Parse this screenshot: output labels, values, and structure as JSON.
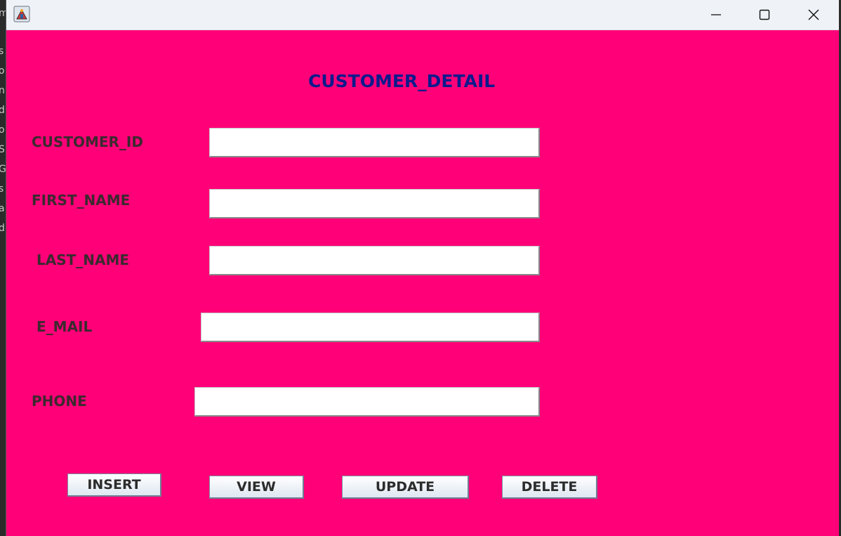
{
  "window": {
    "icons": {
      "app": "java-app-icon",
      "minimize": "minimize-icon",
      "maximize": "maximize-icon",
      "close": "close-icon"
    }
  },
  "form": {
    "title": "CUSTOMER_DETAIL",
    "fields": {
      "customer_id": {
        "label": "CUSTOMER_ID",
        "value": ""
      },
      "first_name": {
        "label": "FIRST_NAME",
        "value": ""
      },
      "last_name": {
        "label": "LAST_NAME",
        "value": ""
      },
      "email": {
        "label": "E_MAIL",
        "value": ""
      },
      "phone": {
        "label": "PHONE",
        "value": ""
      }
    },
    "buttons": {
      "insert": "INSERT",
      "view": "VIEW",
      "update": "UPDATE",
      "delete": "DELETE"
    }
  },
  "colors": {
    "background": "#ff0078",
    "title": "#0c1a8c",
    "label": "#3b2a2f"
  },
  "background_app": {
    "left_edge_letters": [
      "m",
      "s",
      "o",
      "n",
      "d",
      "o",
      "S",
      "G",
      "s",
      "a",
      "d"
    ]
  }
}
